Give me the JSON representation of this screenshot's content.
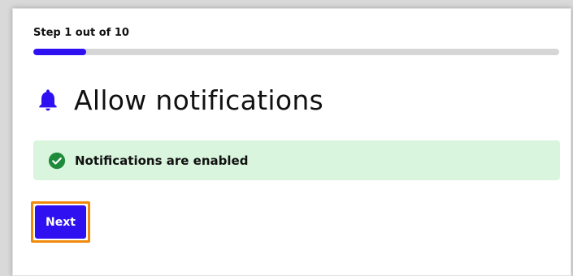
{
  "step": {
    "label": "Step 1 out of 10",
    "current": 1,
    "total": 10,
    "progress_fraction": 0.1
  },
  "heading": {
    "icon": "bell-icon",
    "title": "Allow notifications"
  },
  "alert": {
    "icon": "check-circle-icon",
    "text": "Notifications are enabled"
  },
  "actions": {
    "next_label": "Next"
  },
  "colors": {
    "accent": "#2e10f0",
    "success_bg": "#d9f5dd",
    "success_icon": "#1f8a3a",
    "focus_ring": "#f08a0a",
    "track": "#d6d6d6"
  }
}
